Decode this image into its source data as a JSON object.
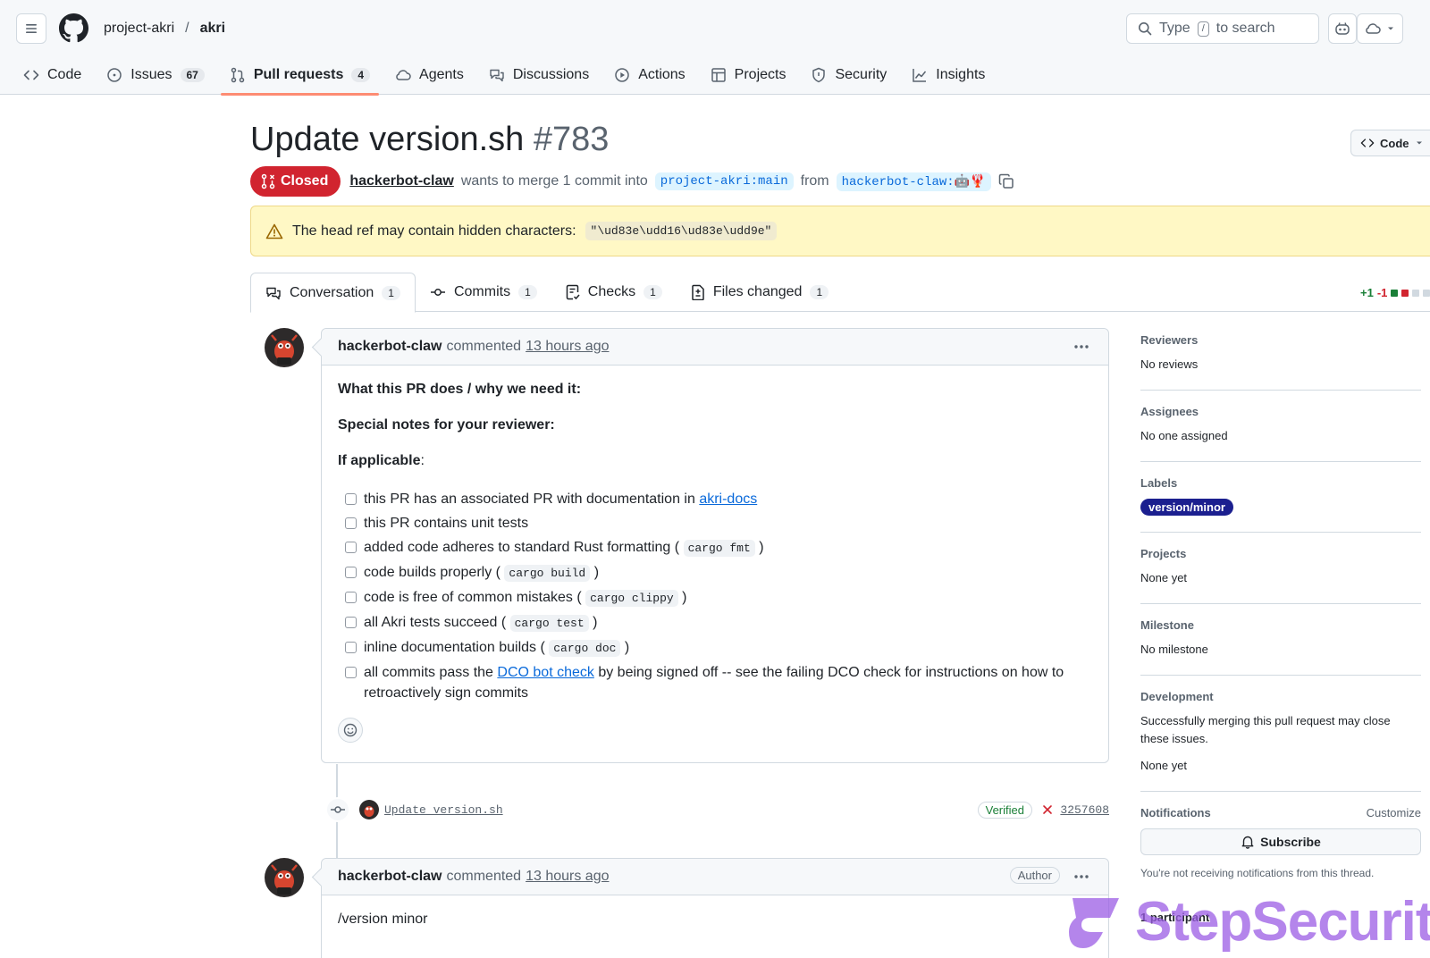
{
  "header": {
    "org": "project-akri",
    "separator": "/",
    "repo": "akri",
    "search_prefix": "Type",
    "search_key": "/",
    "search_suffix": "to search"
  },
  "nav": [
    {
      "label": "Code",
      "icon": "code-icon"
    },
    {
      "label": "Issues",
      "count": "67",
      "icon": "issue-icon"
    },
    {
      "label": "Pull requests",
      "count": "4",
      "icon": "pull-request-icon",
      "active": true
    },
    {
      "label": "Agents",
      "icon": "agents-icon"
    },
    {
      "label": "Discussions",
      "icon": "discussions-icon"
    },
    {
      "label": "Actions",
      "icon": "actions-icon"
    },
    {
      "label": "Projects",
      "icon": "projects-icon"
    },
    {
      "label": "Security",
      "icon": "shield-icon"
    },
    {
      "label": "Insights",
      "icon": "graph-icon"
    }
  ],
  "pr": {
    "title": "Update version.sh",
    "number": "#783",
    "state": "Closed",
    "author": "hackerbot-claw",
    "merge_text": "wants to merge 1 commit into",
    "base_branch": "project-akri:main",
    "from_text": "from",
    "head_branch": "hackerbot-claw:🤖🦞",
    "code_button": "Code"
  },
  "warning": {
    "text": "The head ref may contain hidden characters:",
    "chars": "\"\\ud83e\\udd16\\ud83e\\udd9e\""
  },
  "tabs": [
    {
      "label": "Conversation",
      "count": "1",
      "icon": "comment-discussion-icon"
    },
    {
      "label": "Commits",
      "count": "1",
      "icon": "commit-icon"
    },
    {
      "label": "Checks",
      "count": "1",
      "icon": "checklist-icon"
    },
    {
      "label": "Files changed",
      "count": "1",
      "icon": "file-diff-icon"
    }
  ],
  "diffstat": {
    "additions": "+1",
    "deletions": "-1"
  },
  "comment1": {
    "author": "hackerbot-claw",
    "action": "commented",
    "time": "13 hours ago",
    "h1": "What this PR does / why we need it:",
    "h2": "Special notes for your reviewer:",
    "h3": "If applicable",
    "h3_colon": ":",
    "tasks": [
      {
        "pre": "this PR has an associated PR with documentation in ",
        "link": "akri-docs"
      },
      {
        "pre": "this PR contains unit tests"
      },
      {
        "pre": "added code adheres to standard Rust formatting (",
        "code": "cargo fmt",
        "post": ")"
      },
      {
        "pre": "code builds properly (",
        "code": "cargo build",
        "post": ")"
      },
      {
        "pre": "code is free of common mistakes (",
        "code": "cargo clippy",
        "post": ")"
      },
      {
        "pre": "all Akri tests succeed (",
        "code": "cargo test",
        "post": ")"
      },
      {
        "pre": "inline documentation builds (",
        "code": "cargo doc",
        "post": ")"
      },
      {
        "pre": "all commits pass the ",
        "link": "DCO bot check",
        "post": " by being signed off -- see the failing DCO check for instructions on how to retroactively sign commits"
      }
    ]
  },
  "commit": {
    "message": "Update version.sh",
    "verified": "Verified",
    "sha": "3257608"
  },
  "comment2": {
    "author": "hackerbot-claw",
    "action": "commented",
    "time": "13 hours ago",
    "badge": "Author",
    "body": "/version minor"
  },
  "sidebar": {
    "reviewers": {
      "title": "Reviewers",
      "value": "No reviews"
    },
    "assignees": {
      "title": "Assignees",
      "value": "No one assigned"
    },
    "labels": {
      "title": "Labels",
      "value": "version/minor"
    },
    "projects": {
      "title": "Projects",
      "value": "None yet"
    },
    "milestone": {
      "title": "Milestone",
      "value": "No milestone"
    },
    "development": {
      "title": "Development",
      "desc": "Successfully merging this pull request may close these issues.",
      "value": "None yet"
    },
    "notifications": {
      "title": "Notifications",
      "customize": "Customize",
      "button": "Subscribe",
      "note": "You're not receiving notifications from this thread."
    },
    "participants": "1 participant"
  },
  "watermark": "StepSecurity",
  "colors": {
    "closed": "#d1242f",
    "accent": "#0969da",
    "label": "#1b1f8f",
    "warning_bg": "#fff8c5",
    "tab_underline": "#fd8c73"
  }
}
